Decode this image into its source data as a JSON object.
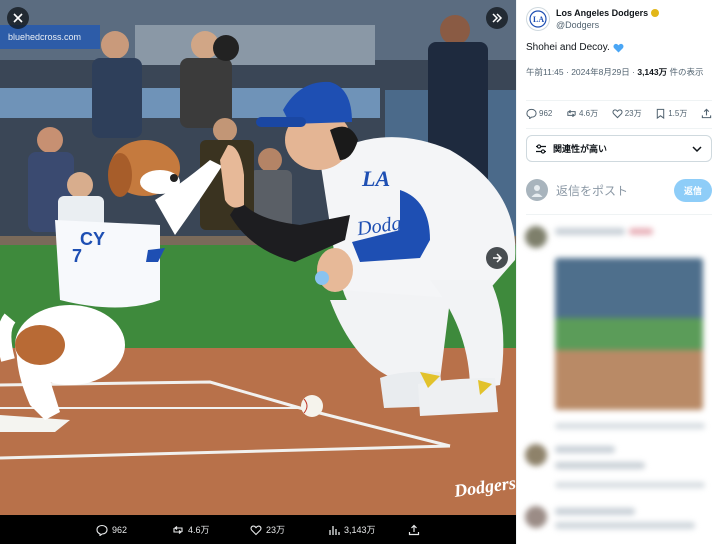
{
  "media": {
    "watermark": "Dodgers",
    "bib_text": "CY",
    "cap_logo": "LA",
    "jersey_text": "Dodgers",
    "ad_board_text": "bluehedcross.com"
  },
  "media_actions": {
    "replies": "962",
    "reposts": "4.6万",
    "likes": "23万",
    "views": "3,143万"
  },
  "tweet": {
    "author_name": "Los Angeles Dodgers",
    "author_handle": "@Dodgers",
    "text": "Shohei and Decoy.",
    "time": "午前11:45 · 2024年8月29日 · ",
    "views_count": "3,143万",
    "views_suffix": " 件の表示"
  },
  "actions": {
    "replies": "962",
    "reposts": "4.6万",
    "likes": "23万",
    "bookmarks": "1.5万"
  },
  "sort": {
    "label": "関連性が高い"
  },
  "reply": {
    "placeholder": "返信をポスト",
    "button": "返信"
  },
  "colors": {
    "accent": "#1d9bf0",
    "heart": "#4aa6f5",
    "dodger_blue": "#1e4fb3",
    "field_green": "#3e8a3c",
    "dirt": "#b8714a"
  }
}
